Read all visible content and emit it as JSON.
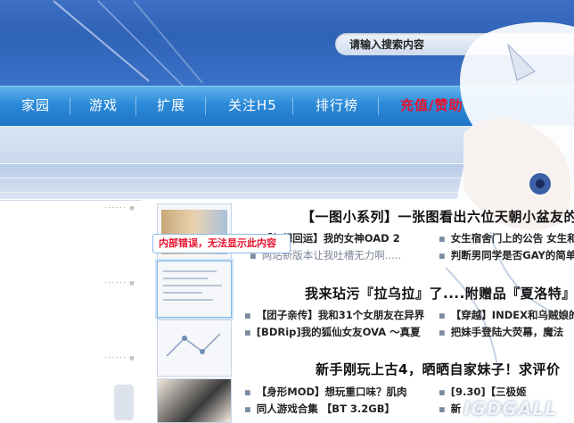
{
  "search": {
    "placeholder": "请输入搜索内容"
  },
  "nav": {
    "items": [
      {
        "label": "家园"
      },
      {
        "label": "游戏"
      },
      {
        "label": "扩展"
      },
      {
        "label": "关注H5"
      },
      {
        "label": "排行榜"
      },
      {
        "label": "充值/赞助"
      }
    ],
    "highlight_color": "#e8112d"
  },
  "error_tip": "内部错误，无法显示此内容",
  "headlines": [
    "【一图小系列】一张图看出六位天朝小盆友的",
    "我来玷污『拉乌拉』了....附赠品『夏洛特』",
    "新手刚玩上古4，晒晒自家妹子！求评价"
  ],
  "items": [
    "【幻想回运】我的女神OAD 2",
    "女生宿舍门上的公告 女生和",
    "网站新版本让我吐槽无力啊.....",
    "判断男同学是否GAY的简单",
    "【团子亲传】我和31个女朋友在异界",
    "【穿越】INDEX和乌贼娘的",
    "[BDRip]我的狐仙女友OVA ～真夏",
    "把妹手登陆大荧幕，魔法",
    "【身形MOD】想玩重口味？肌肉",
    "[9.30]【三极姬",
    "同人游戏合集 【BT 3.2GB】",
    "新"
  ],
  "watermark": "IGDGALL",
  "colors": {
    "banner": "#2f63b8",
    "nav": "#2b8ad8",
    "accent_red": "#e8112d"
  }
}
